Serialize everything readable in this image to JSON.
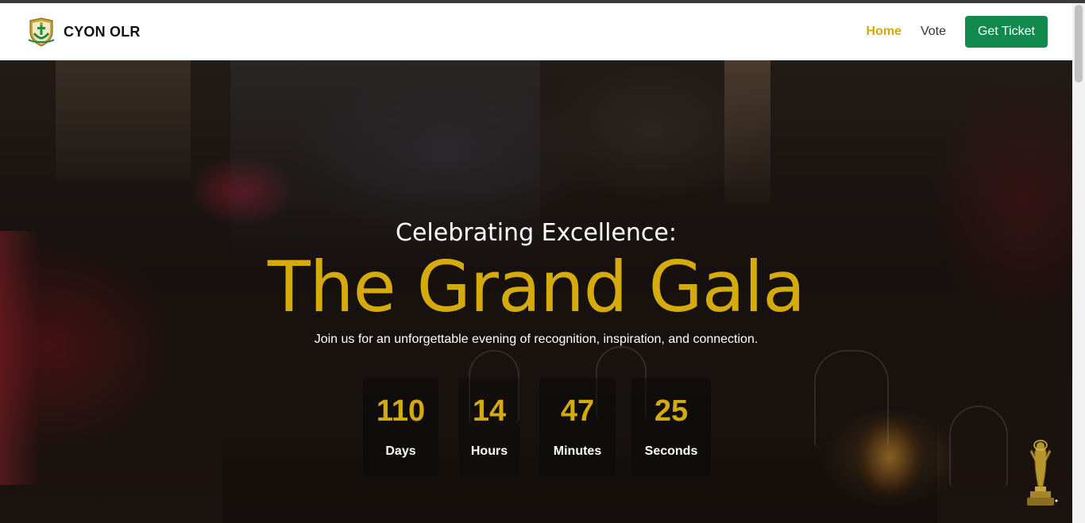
{
  "brand": {
    "name": "CYON OLR"
  },
  "nav": {
    "items": [
      {
        "label": "Home"
      },
      {
        "label": "Vote"
      }
    ],
    "cta_label": "Get Ticket"
  },
  "hero": {
    "subtitle": "Celebrating Excellence:",
    "title": "The Grand Gala",
    "tagline": "Join us for an unforgettable evening of recognition, inspiration, and connection."
  },
  "countdown": [
    {
      "value": "110",
      "label": "Days"
    },
    {
      "value": "14",
      "label": "Hours"
    },
    {
      "value": "47",
      "label": "Minutes"
    },
    {
      "value": "25",
      "label": "Seconds"
    }
  ],
  "icons": {
    "logo": "crest-logo-icon",
    "trophy": "trophy-statuette-icon"
  },
  "colors": {
    "accent_gold": "#d4aa0c",
    "cta_green": "#0f8a4c",
    "nav_text": "#333333"
  }
}
